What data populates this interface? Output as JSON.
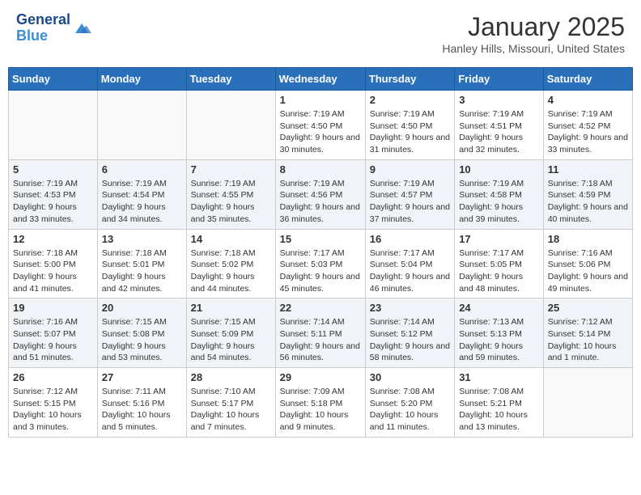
{
  "app": {
    "name": "GeneralBlue",
    "logo_line1": "General",
    "logo_line2": "Blue"
  },
  "header": {
    "title": "January 2025",
    "location": "Hanley Hills, Missouri, United States"
  },
  "weekdays": [
    "Sunday",
    "Monday",
    "Tuesday",
    "Wednesday",
    "Thursday",
    "Friday",
    "Saturday"
  ],
  "weeks": [
    [
      {
        "day": "",
        "info": ""
      },
      {
        "day": "",
        "info": ""
      },
      {
        "day": "",
        "info": ""
      },
      {
        "day": "1",
        "info": "Sunrise: 7:19 AM\nSunset: 4:50 PM\nDaylight: 9 hours and 30 minutes."
      },
      {
        "day": "2",
        "info": "Sunrise: 7:19 AM\nSunset: 4:50 PM\nDaylight: 9 hours and 31 minutes."
      },
      {
        "day": "3",
        "info": "Sunrise: 7:19 AM\nSunset: 4:51 PM\nDaylight: 9 hours and 32 minutes."
      },
      {
        "day": "4",
        "info": "Sunrise: 7:19 AM\nSunset: 4:52 PM\nDaylight: 9 hours and 33 minutes."
      }
    ],
    [
      {
        "day": "5",
        "info": "Sunrise: 7:19 AM\nSunset: 4:53 PM\nDaylight: 9 hours and 33 minutes."
      },
      {
        "day": "6",
        "info": "Sunrise: 7:19 AM\nSunset: 4:54 PM\nDaylight: 9 hours and 34 minutes."
      },
      {
        "day": "7",
        "info": "Sunrise: 7:19 AM\nSunset: 4:55 PM\nDaylight: 9 hours and 35 minutes."
      },
      {
        "day": "8",
        "info": "Sunrise: 7:19 AM\nSunset: 4:56 PM\nDaylight: 9 hours and 36 minutes."
      },
      {
        "day": "9",
        "info": "Sunrise: 7:19 AM\nSunset: 4:57 PM\nDaylight: 9 hours and 37 minutes."
      },
      {
        "day": "10",
        "info": "Sunrise: 7:19 AM\nSunset: 4:58 PM\nDaylight: 9 hours and 39 minutes."
      },
      {
        "day": "11",
        "info": "Sunrise: 7:18 AM\nSunset: 4:59 PM\nDaylight: 9 hours and 40 minutes."
      }
    ],
    [
      {
        "day": "12",
        "info": "Sunrise: 7:18 AM\nSunset: 5:00 PM\nDaylight: 9 hours and 41 minutes."
      },
      {
        "day": "13",
        "info": "Sunrise: 7:18 AM\nSunset: 5:01 PM\nDaylight: 9 hours and 42 minutes."
      },
      {
        "day": "14",
        "info": "Sunrise: 7:18 AM\nSunset: 5:02 PM\nDaylight: 9 hours and 44 minutes."
      },
      {
        "day": "15",
        "info": "Sunrise: 7:17 AM\nSunset: 5:03 PM\nDaylight: 9 hours and 45 minutes."
      },
      {
        "day": "16",
        "info": "Sunrise: 7:17 AM\nSunset: 5:04 PM\nDaylight: 9 hours and 46 minutes."
      },
      {
        "day": "17",
        "info": "Sunrise: 7:17 AM\nSunset: 5:05 PM\nDaylight: 9 hours and 48 minutes."
      },
      {
        "day": "18",
        "info": "Sunrise: 7:16 AM\nSunset: 5:06 PM\nDaylight: 9 hours and 49 minutes."
      }
    ],
    [
      {
        "day": "19",
        "info": "Sunrise: 7:16 AM\nSunset: 5:07 PM\nDaylight: 9 hours and 51 minutes."
      },
      {
        "day": "20",
        "info": "Sunrise: 7:15 AM\nSunset: 5:08 PM\nDaylight: 9 hours and 53 minutes."
      },
      {
        "day": "21",
        "info": "Sunrise: 7:15 AM\nSunset: 5:09 PM\nDaylight: 9 hours and 54 minutes."
      },
      {
        "day": "22",
        "info": "Sunrise: 7:14 AM\nSunset: 5:11 PM\nDaylight: 9 hours and 56 minutes."
      },
      {
        "day": "23",
        "info": "Sunrise: 7:14 AM\nSunset: 5:12 PM\nDaylight: 9 hours and 58 minutes."
      },
      {
        "day": "24",
        "info": "Sunrise: 7:13 AM\nSunset: 5:13 PM\nDaylight: 9 hours and 59 minutes."
      },
      {
        "day": "25",
        "info": "Sunrise: 7:12 AM\nSunset: 5:14 PM\nDaylight: 10 hours and 1 minute."
      }
    ],
    [
      {
        "day": "26",
        "info": "Sunrise: 7:12 AM\nSunset: 5:15 PM\nDaylight: 10 hours and 3 minutes."
      },
      {
        "day": "27",
        "info": "Sunrise: 7:11 AM\nSunset: 5:16 PM\nDaylight: 10 hours and 5 minutes."
      },
      {
        "day": "28",
        "info": "Sunrise: 7:10 AM\nSunset: 5:17 PM\nDaylight: 10 hours and 7 minutes."
      },
      {
        "day": "29",
        "info": "Sunrise: 7:09 AM\nSunset: 5:18 PM\nDaylight: 10 hours and 9 minutes."
      },
      {
        "day": "30",
        "info": "Sunrise: 7:08 AM\nSunset: 5:20 PM\nDaylight: 10 hours and 11 minutes."
      },
      {
        "day": "31",
        "info": "Sunrise: 7:08 AM\nSunset: 5:21 PM\nDaylight: 10 hours and 13 minutes."
      },
      {
        "day": "",
        "info": ""
      }
    ]
  ]
}
